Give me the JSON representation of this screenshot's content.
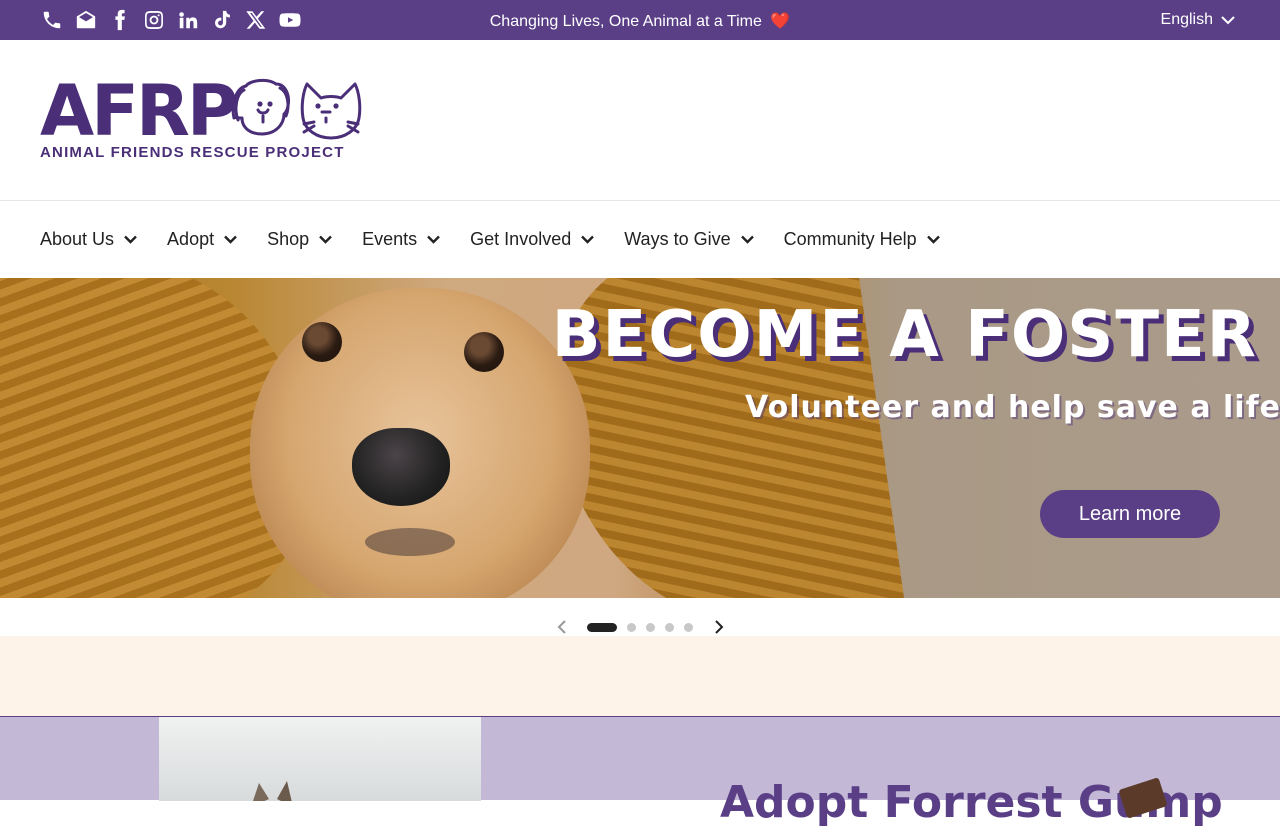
{
  "topbar": {
    "social_icons": [
      "phone-icon",
      "email-icon",
      "facebook-icon",
      "instagram-icon",
      "linkedin-icon",
      "tiktok-icon",
      "x-icon",
      "youtube-icon"
    ],
    "tagline": "Changing Lives, One Animal at a Time",
    "tagline_emoji": "❤️",
    "language": "English"
  },
  "logo": {
    "wordmark": "AFRP",
    "subtitle": "ANIMAL FRIENDS RESCUE PROJECT"
  },
  "nav": {
    "items": [
      {
        "label": "About Us"
      },
      {
        "label": "Adopt"
      },
      {
        "label": "Shop"
      },
      {
        "label": "Events"
      },
      {
        "label": "Get Involved"
      },
      {
        "label": "Ways to Give"
      },
      {
        "label": "Community Help"
      }
    ]
  },
  "hero": {
    "title": "BECOME A FOSTER",
    "subtitle": "Volunteer and help save a life!",
    "cta_label": "Learn more"
  },
  "slider": {
    "slide_count": 5,
    "active_index": 0
  },
  "feature": {
    "title": "Adopt Forrest Gump"
  },
  "colors": {
    "brand_purple": "#5a3f87",
    "cream": "#fdf3e8",
    "lavender": "#c3b8d6",
    "heart_red": "#e3342f"
  }
}
